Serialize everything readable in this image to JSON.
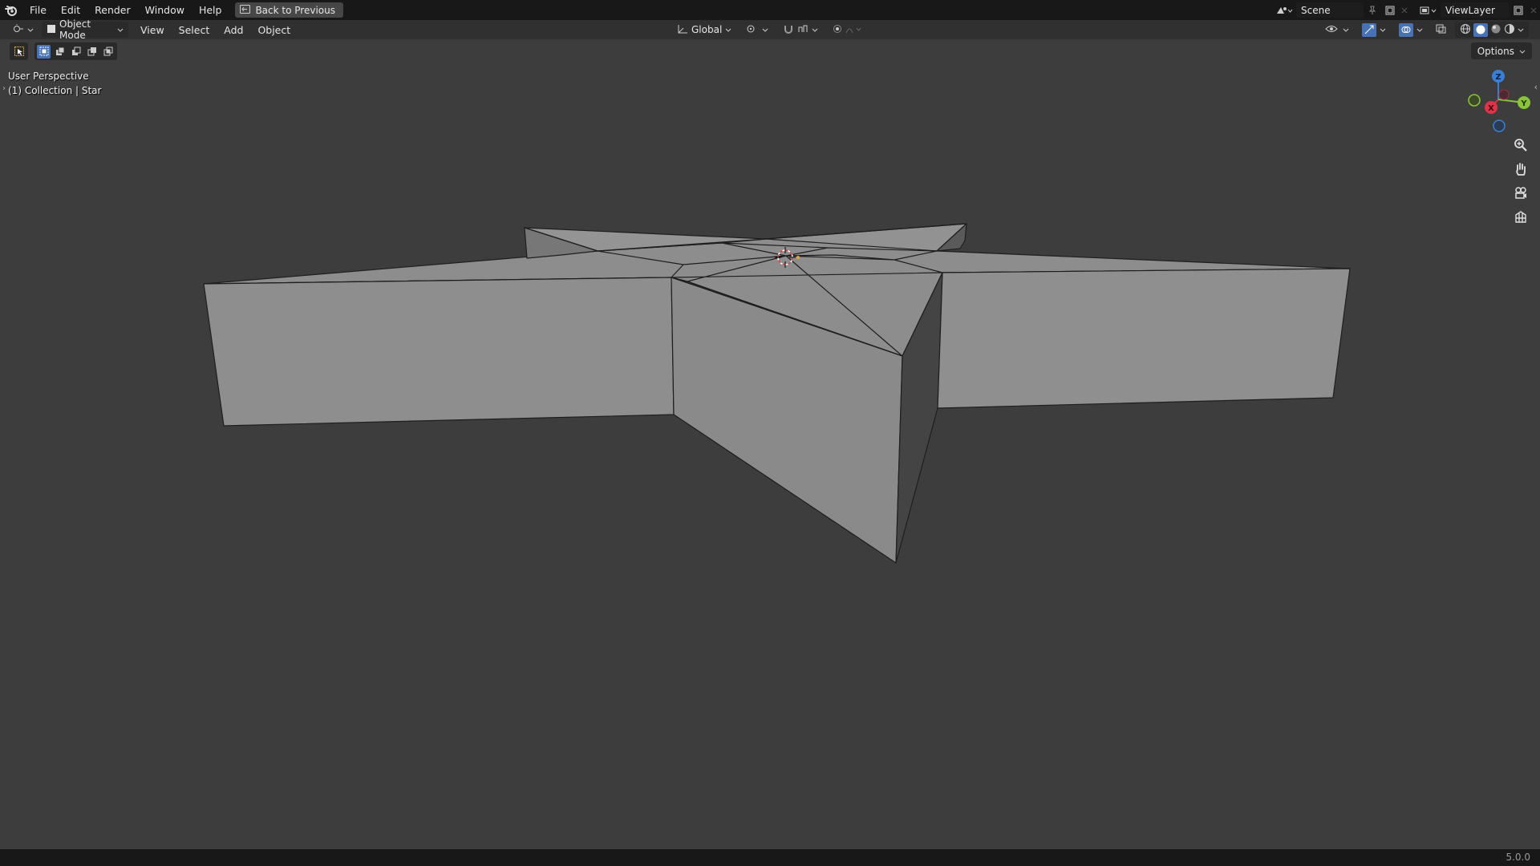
{
  "topbar": {
    "menus": [
      "File",
      "Edit",
      "Render",
      "Window",
      "Help"
    ],
    "back_button": "Back to Previous",
    "scene": "Scene",
    "view_layer": "ViewLayer"
  },
  "header": {
    "mode": "Object Mode",
    "menus": [
      "View",
      "Select",
      "Add",
      "Object"
    ],
    "transform_orientation": "Global"
  },
  "viewport": {
    "view_name": "User Perspective",
    "collection_label": "(1) Collection | Star",
    "options_label": "Options",
    "gizmo_axes": [
      "Z",
      "X",
      "Y"
    ]
  },
  "statusbar": {
    "version": "5.0.0"
  },
  "colors": {
    "accent": "#4772b3",
    "axis_x": "#e0334a",
    "axis_y": "#8bc43a",
    "axis_z": "#3a7fd6"
  }
}
